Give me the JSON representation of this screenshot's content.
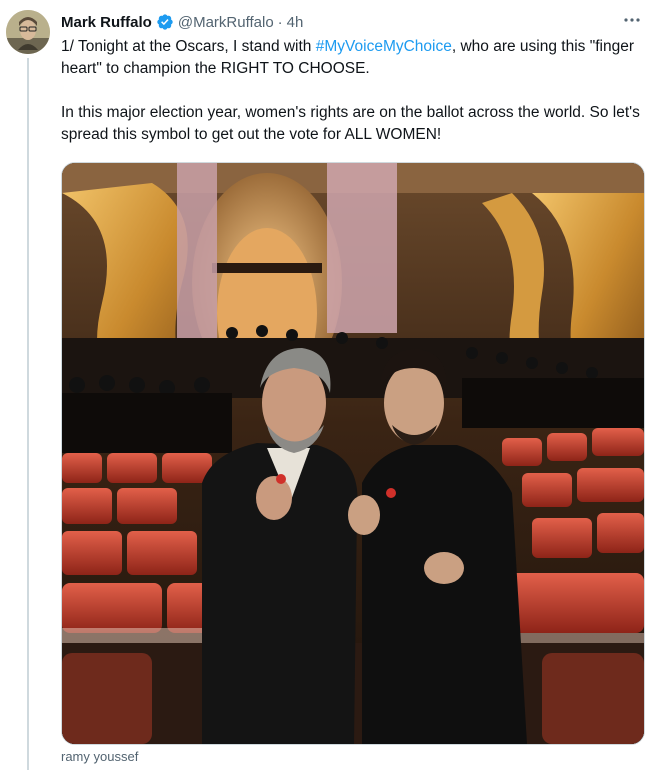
{
  "author": {
    "name": "Mark Ruffalo",
    "handle": "@MarkRuffalo",
    "separator": "·",
    "time": "4h",
    "verified": true,
    "avatar_icon": "profile-avatar"
  },
  "post": {
    "line1_before": "1/ Tonight at the Oscars, I stand with ",
    "hashtag": "#MyVoiceMyChoice",
    "line1_after": ", who are using this \"finger heart\" to champion the RIGHT TO CHOOSE.",
    "paragraph2": "In this major election year, women's rights are on the ballot across the world. So let's spread this symbol to get out the vote for ALL WOMEN!"
  },
  "media": {
    "caption": "ramy youssef"
  },
  "icons": {
    "more": "more-options-icon",
    "verified": "verified-badge-icon"
  },
  "colors": {
    "link": "#1d9bf0",
    "secondary_text": "#536471",
    "verified": "#1d9bf0"
  }
}
